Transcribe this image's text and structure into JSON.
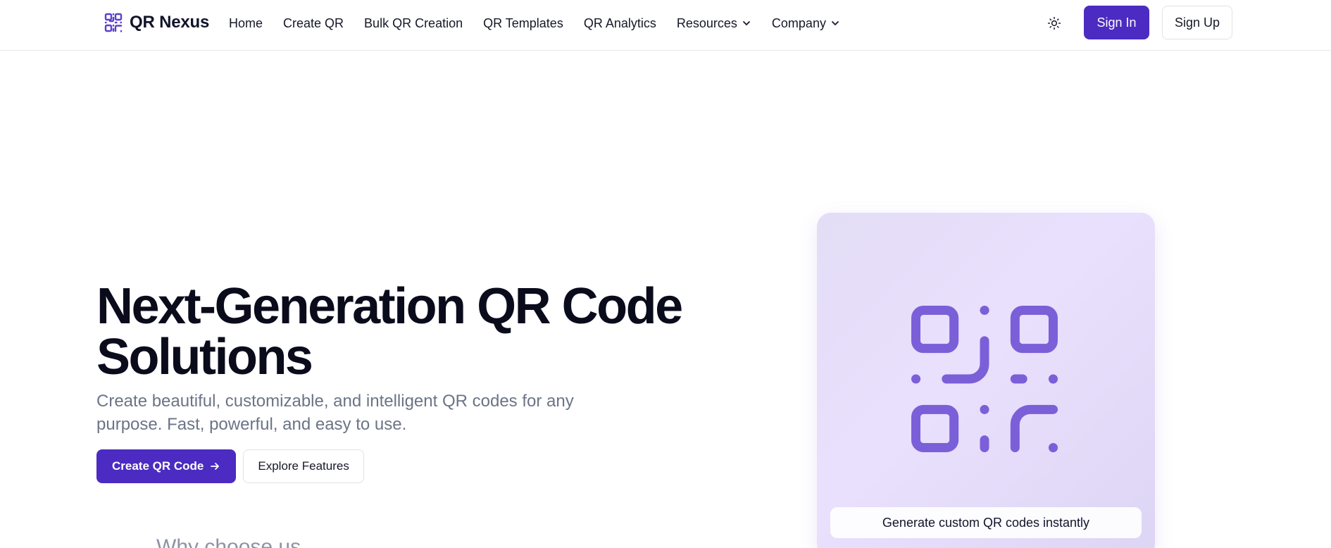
{
  "brand": {
    "name": "QR Nexus",
    "icon": "qr-logo-icon"
  },
  "nav": {
    "items": [
      {
        "label": "Home"
      },
      {
        "label": "Create QR"
      },
      {
        "label": "Bulk QR Creation"
      },
      {
        "label": "QR Templates"
      },
      {
        "label": "QR Analytics"
      },
      {
        "label": "Resources",
        "icon": "chevron-down-icon"
      },
      {
        "label": "Company",
        "icon": "chevron-down-icon"
      }
    ],
    "theme_toggle_icon": "sun-icon",
    "sign_in": "Sign In",
    "sign_up": "Sign Up"
  },
  "hero": {
    "title_line1": "Next-Generation QR Code",
    "title_line2": "Solutions",
    "subtitle_line1": "Create beautiful, customizable, and intelligent QR codes for any",
    "subtitle_line2": "purpose. Fast, powerful, and easy to use.",
    "primary_cta": "Create QR Code",
    "primary_cta_icon": "arrow-right-icon",
    "secondary_cta": "Explore Features",
    "partial_heading": "Why choose us"
  },
  "visual": {
    "icon": "qr-code-icon",
    "caption": "Generate custom QR codes instantly"
  },
  "colors": {
    "accent": "#4c2bc2",
    "qr_icon": "#7b5fd8",
    "card_bg": "#e6def8",
    "subtitle": "#6b7487"
  }
}
